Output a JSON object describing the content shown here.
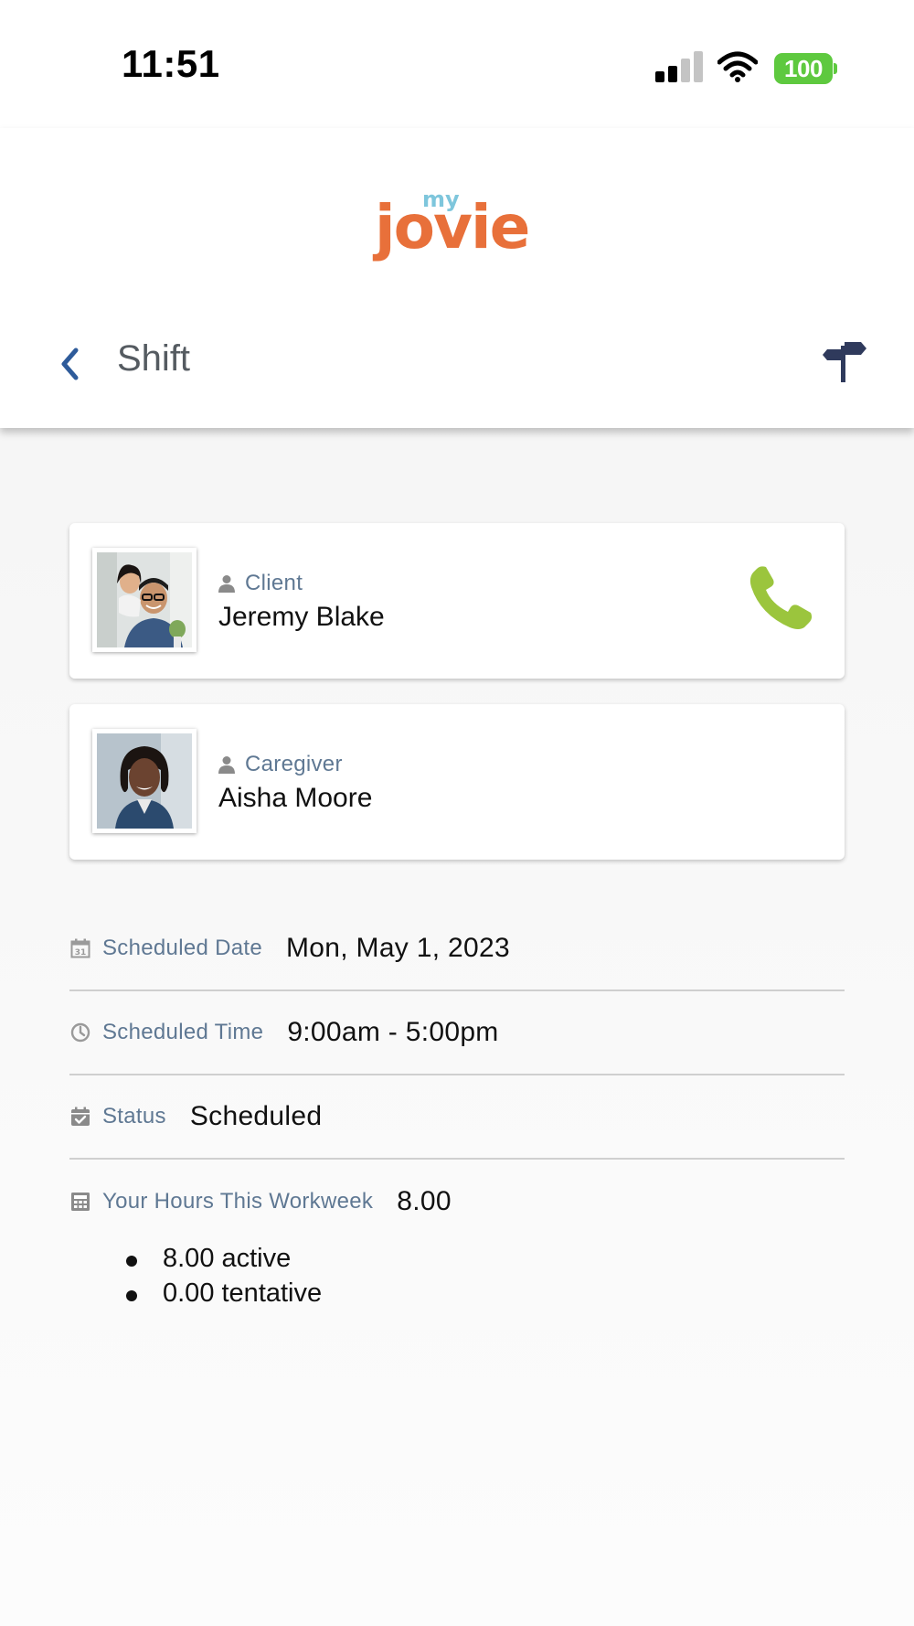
{
  "status_bar": {
    "time": "11:51",
    "battery": "100",
    "battery_color": "#5ec93f"
  },
  "header": {
    "logo": {
      "prefix": "my",
      "name": "jovie",
      "name_color": "#e8703a",
      "prefix_color": "#7ec6dc"
    },
    "title": "Shift",
    "back_icon": "chevron-left-icon",
    "action_icon": "signpost-icon"
  },
  "client": {
    "role": "Client",
    "name": "Jeremy Blake",
    "photo": "client-photo",
    "call_icon": "phone-icon",
    "call_color": "#9bc53d"
  },
  "caregiver": {
    "role": "Caregiver",
    "name": "Aisha Moore",
    "photo": "caregiver-photo"
  },
  "details": {
    "date": {
      "icon": "calendar-icon",
      "label": "Scheduled Date",
      "value": "Mon, May 1, 2023"
    },
    "time": {
      "icon": "clock-icon",
      "label": "Scheduled Time",
      "value": "9:00am - 5:00pm"
    },
    "status": {
      "icon": "calendar-check-icon",
      "label": "Status",
      "value": "Scheduled"
    },
    "hours": {
      "icon": "calculator-icon",
      "label": "Your Hours This Workweek",
      "value": "8.00",
      "breakdown": [
        "8.00 active",
        "0.00 tentative"
      ]
    }
  },
  "accent_color": "#2e5b9a",
  "label_color": "#5f7893"
}
